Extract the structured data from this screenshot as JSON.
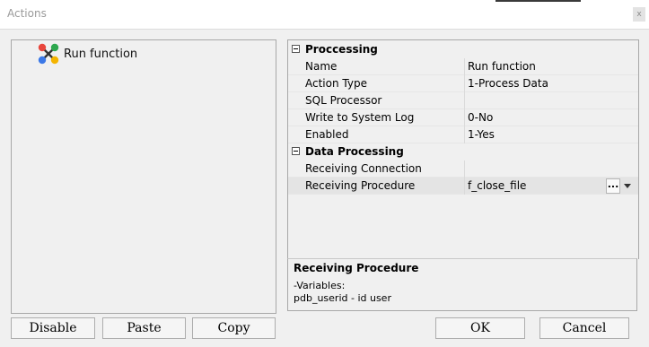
{
  "window": {
    "title": "Actions",
    "close_glyph": "x"
  },
  "tree": {
    "items": [
      {
        "label": "Run function",
        "icon": "run-function-icon"
      }
    ]
  },
  "property_grid": {
    "categories": [
      {
        "label": "Proccessing",
        "rows": [
          {
            "name": "Name",
            "value": "Run function"
          },
          {
            "name": "Action Type",
            "value": "1-Process Data"
          },
          {
            "name": "SQL Processor",
            "value": ""
          },
          {
            "name": "Write to System Log",
            "value": "0-No"
          },
          {
            "name": "Enabled",
            "value": "1-Yes"
          }
        ]
      },
      {
        "label": "Data Processing",
        "rows": [
          {
            "name": "Receiving Connection",
            "value": ""
          },
          {
            "name": "Receiving Procedure",
            "value": "f_close_file",
            "ellipsis": "..."
          }
        ]
      }
    ]
  },
  "description": {
    "title": "Receiving Procedure",
    "lines": [
      "-Variables:",
      "pdb_userid - id user"
    ]
  },
  "buttons": {
    "disable": "Disable",
    "paste": "Paste",
    "copy": "Copy",
    "ok": "OK",
    "cancel": "Cancel"
  },
  "colors": {
    "panel": "#f0f0f0",
    "border": "#a8a8a8",
    "selected_row": "#e4e4e4",
    "icon_red": "#e8453c",
    "icon_green": "#2ea84f",
    "icon_blue": "#3b78e7",
    "icon_yellow": "#f4b400"
  }
}
